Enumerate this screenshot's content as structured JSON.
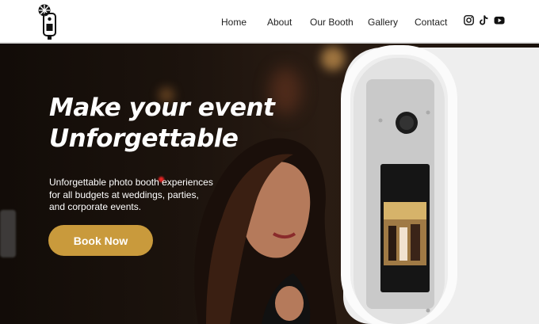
{
  "nav": {
    "items": [
      {
        "label": "Home"
      },
      {
        "label": "About"
      },
      {
        "label": "Our Booth"
      },
      {
        "label": "Gallery"
      },
      {
        "label": "Contact"
      }
    ]
  },
  "social": {
    "icons": [
      "instagram-icon",
      "tiktok-icon",
      "youtube-icon"
    ]
  },
  "hero": {
    "headline_line1": "Make your event",
    "headline_line2": "Unforgettable",
    "tagline_line1": "Unforgettable photo booth experiences",
    "tagline_line2": "for all budgets at weddings, parties,",
    "tagline_line3": "and corporate events.",
    "book_button": "Book Now"
  },
  "colors": {
    "accent": "#c99a3c",
    "header_bg": "#ffffff",
    "nav_text": "#222222",
    "hero_text": "#ffffff"
  }
}
